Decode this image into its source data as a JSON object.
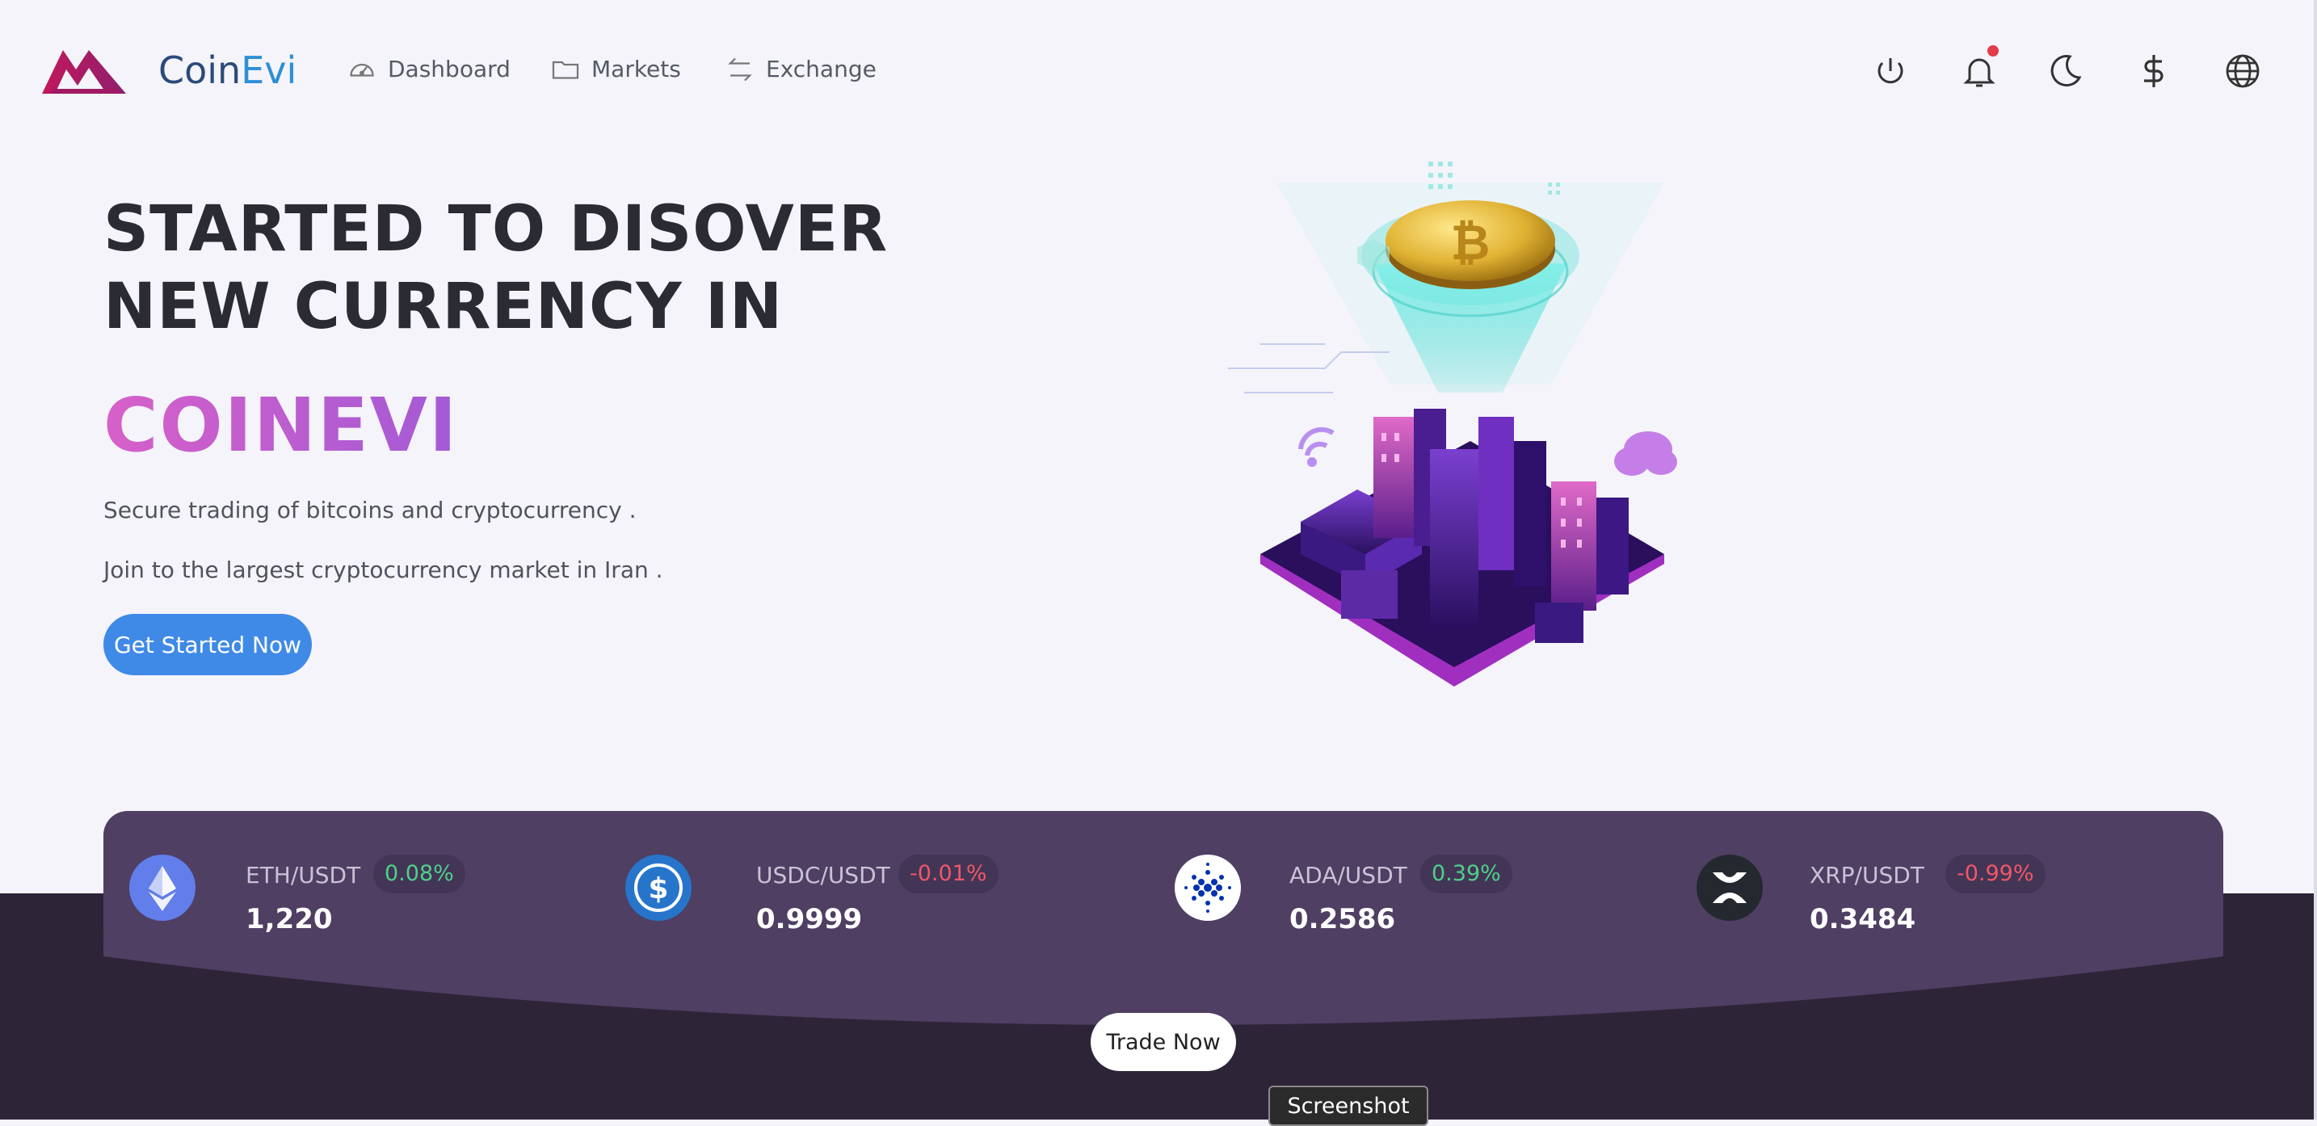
{
  "brand": {
    "name_part1": "Coin",
    "name_part2": "Evi"
  },
  "nav": [
    {
      "label": "Dashboard",
      "icon": "dashboard-gauge-icon"
    },
    {
      "label": "Markets",
      "icon": "folder-icon"
    },
    {
      "label": "Exchange",
      "icon": "exchange-arrows-icon"
    }
  ],
  "header_icons": [
    "power-icon",
    "bell-icon",
    "moon-icon",
    "dollar-icon",
    "globe-icon"
  ],
  "hero": {
    "title": "STARTED TO DISOVER NEW CURRENCY IN",
    "brand": "COINEVI",
    "line1": "Secure trading of bitcoins and cryptocurrency .",
    "line2": "Join to the largest cryptocurrency market in Iran .",
    "cta": "Get Started Now"
  },
  "tickers": [
    {
      "pair": "ETH/USDT",
      "change": "0.08%",
      "direction": "up",
      "price": "1,220",
      "icon": "ethereum-icon",
      "color": "#627eea"
    },
    {
      "pair": "USDC/USDT",
      "change": "-0.01%",
      "direction": "down",
      "price": "0.9999",
      "icon": "usdc-icon",
      "color": "#2775ca"
    },
    {
      "pair": "ADA/USDT",
      "change": "0.39%",
      "direction": "up",
      "price": "0.2586",
      "icon": "cardano-icon",
      "color": "#0033ad"
    },
    {
      "pair": "XRP/USDT",
      "change": "-0.99%",
      "direction": "down",
      "price": "0.3484",
      "icon": "xrp-icon",
      "color": "#23292f"
    }
  ],
  "trade_button": "Trade Now",
  "tooltip": "Screenshot",
  "colors": {
    "accent": "#3f8ae6",
    "dark_band": "#2e2438",
    "ticker_card": "#4f3f63",
    "up": "#4ed08a",
    "down": "#ef5767",
    "brand_gradient_start": "#d760c9",
    "brand_gradient_end": "#a35ad6"
  }
}
